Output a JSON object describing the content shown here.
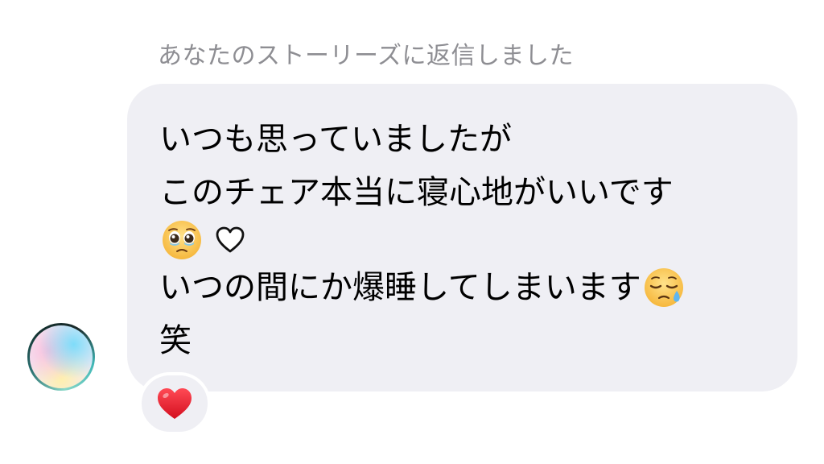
{
  "chat": {
    "story_reply_label": "あなたのストーリーズに返信しました",
    "message": {
      "line1": "いつも思っていましたが",
      "line2": "このチェア本当に寝心地がいいです",
      "line4": "いつの間にか爆睡してしまいます",
      "line5": "笑"
    },
    "emojis": {
      "pleading_face": "pleading-face-icon",
      "white_heart": "white-heart-icon",
      "sleepy_face": "sleepy-face-icon"
    },
    "reaction": {
      "emoji": "red-heart-icon"
    },
    "colors": {
      "bubble_bg": "#efeff4",
      "label_text": "#8e8e93",
      "reaction_heart": "#e8202f"
    }
  }
}
